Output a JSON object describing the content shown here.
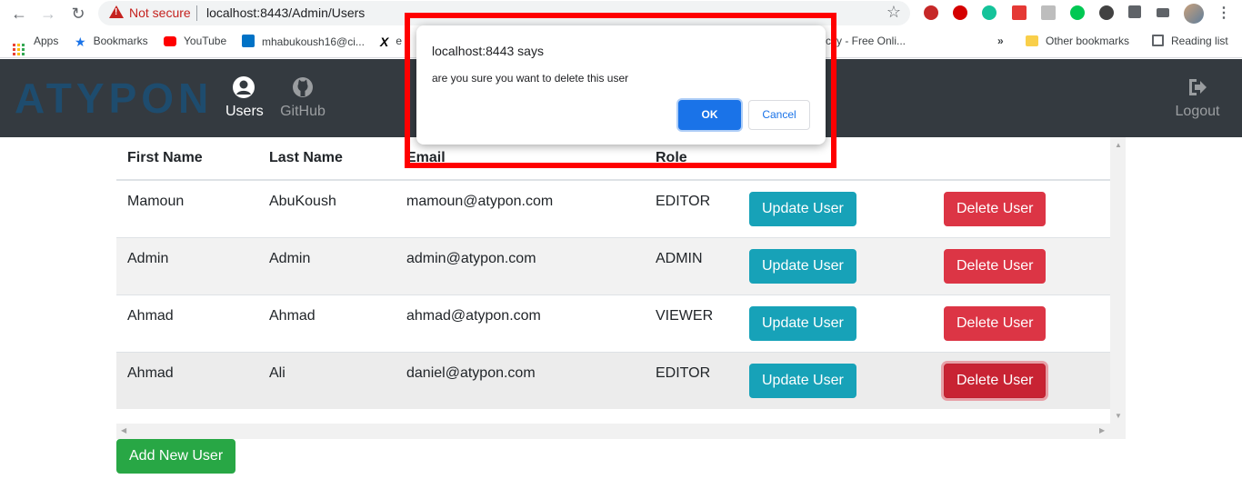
{
  "browser": {
    "security_label": "Not secure",
    "url": "localhost:8443/Admin/Users",
    "bookmarks": [
      {
        "label": "Apps",
        "icon": "apps-grid-icon"
      },
      {
        "label": "Bookmarks",
        "icon": "star-icon"
      },
      {
        "label": "YouTube",
        "icon": "youtube-icon"
      },
      {
        "label": "mhabukoush16@ci...",
        "icon": "outlook-icon"
      },
      {
        "label": "e",
        "icon": "x-icon"
      },
      {
        "label": "city - Free Onli...",
        "icon": ""
      },
      {
        "label": "»",
        "icon": ""
      },
      {
        "label": "Other bookmarks",
        "icon": "folder-icon"
      },
      {
        "label": "Reading list",
        "icon": "reading-list-icon"
      }
    ]
  },
  "navbar": {
    "logo": "ATYPON",
    "items": [
      {
        "label": "Users",
        "icon": "user-circle-icon",
        "active": true
      },
      {
        "label": "GitHub",
        "icon": "github-icon",
        "active": false
      },
      {
        "label": "Logout",
        "icon": "logout-icon",
        "active": false
      }
    ]
  },
  "table": {
    "headers": [
      "First Name",
      "Last Name",
      "Email",
      "Role"
    ],
    "rows": [
      {
        "first": "Mamoun",
        "last": "AbuKoush",
        "email": "mamoun@atypon.com",
        "role": "EDITOR"
      },
      {
        "first": "Admin",
        "last": "Admin",
        "email": "admin@atypon.com",
        "role": "ADMIN"
      },
      {
        "first": "Ahmad",
        "last": "Ahmad",
        "email": "ahmad@atypon.com",
        "role": "VIEWER"
      },
      {
        "first": "Ahmad",
        "last": "Ali",
        "email": "daniel@atypon.com",
        "role": "EDITOR"
      }
    ],
    "update_label": "Update User",
    "delete_label": "Delete User"
  },
  "add_button": "Add New User",
  "dialog": {
    "title": "localhost:8443 says",
    "message": "are you sure you want to delete this user",
    "ok": "OK",
    "cancel": "Cancel"
  },
  "colors": {
    "navbar": "#343a40",
    "info": "#17a2b8",
    "danger": "#dc3545",
    "success": "#28a745",
    "highlight": "#ff0000",
    "dialog_ok": "#1a73e8"
  }
}
